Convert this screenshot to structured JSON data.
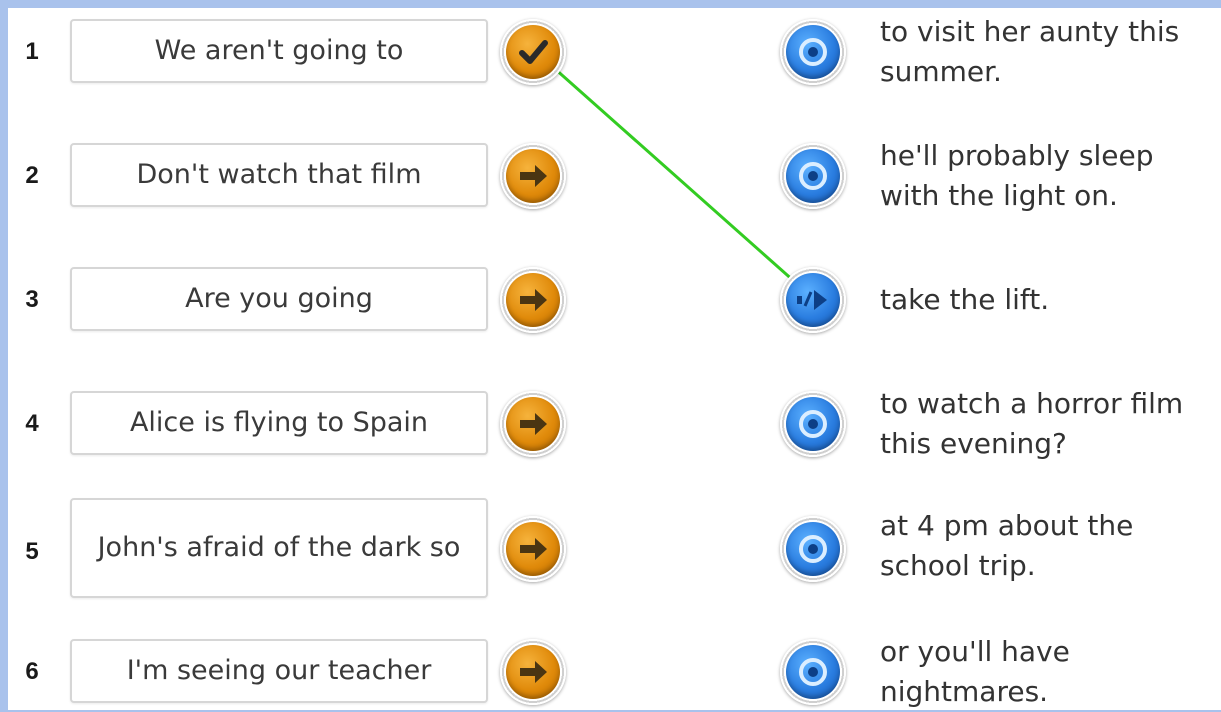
{
  "rows": [
    {
      "number": "1",
      "phrase": "We aren't going to",
      "answer": "to visit her aunty this summer.",
      "left_icon": "check-icon",
      "right_icon": "target-icon"
    },
    {
      "number": "2",
      "phrase": "Don't watch that film",
      "answer": "he'll probably sleep with the light on.",
      "left_icon": "arrow-right-icon",
      "right_icon": "target-icon"
    },
    {
      "number": "3",
      "phrase": "Are you going",
      "answer": "take the lift.",
      "left_icon": "arrow-right-icon",
      "right_icon": "split-arrow-icon"
    },
    {
      "number": "4",
      "phrase": "Alice is flying to Spain",
      "answer": "to watch a horror film this evening?",
      "left_icon": "arrow-right-icon",
      "right_icon": "target-icon"
    },
    {
      "number": "5",
      "phrase": "John's afraid of the dark so",
      "answer": "at 4 pm about the school trip.",
      "left_icon": "arrow-right-icon",
      "right_icon": "target-icon"
    },
    {
      "number": "6",
      "phrase": "I'm seeing our teacher",
      "answer": "or you'll have nightmares.",
      "left_icon": "arrow-right-icon",
      "right_icon": "target-icon"
    }
  ],
  "colors": {
    "page_border": "#a9c2ec",
    "left_button": "#e08a0a",
    "right_button": "#2a7de0",
    "connector": "#33cc22"
  }
}
